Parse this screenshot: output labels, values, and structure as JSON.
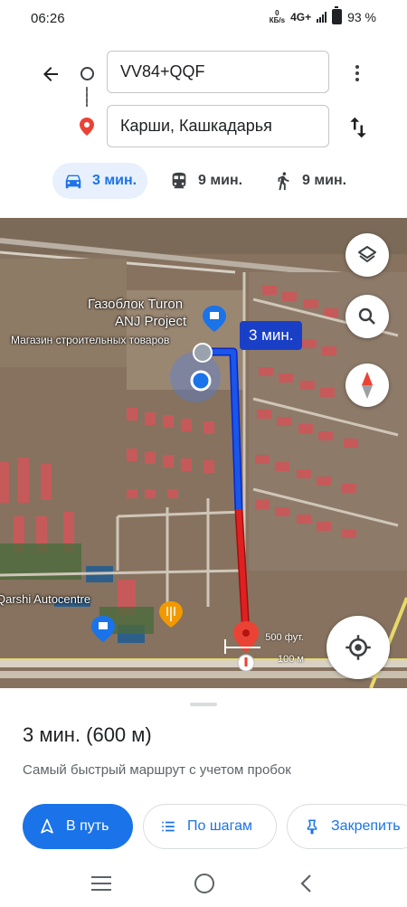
{
  "status_bar": {
    "time": "06:26",
    "net_speed_value": "0",
    "net_speed_unit": "КБ/s",
    "network": "4G+",
    "battery": "93 %"
  },
  "directions": {
    "from": "VV84+QQF",
    "to": "Карши, Кашкадарья",
    "icons": [
      "back-arrow-icon",
      "origin-dot-icon",
      "destination-pin-icon",
      "more-vert-icon",
      "swap-icon"
    ]
  },
  "modes": [
    {
      "icon": "car-icon",
      "label": "3 мин.",
      "selected": true
    },
    {
      "icon": "transit-icon",
      "label": "9 мин.",
      "selected": false
    },
    {
      "icon": "walk-icon",
      "label": "9 мин.",
      "selected": false
    }
  ],
  "map": {
    "labels": {
      "gazoblok": "Газоблок Turon",
      "anj": "ANJ Project",
      "magazin": "Магазин строительных товаров",
      "qarshi": "Qarshi Autocentre"
    },
    "eta": "3 мин.",
    "scale_ft": "500 фут.",
    "scale_m": "100 м",
    "route_colors": {
      "clear": "#1a56e8",
      "traffic": "#e02020"
    },
    "buttons": [
      "layers-icon",
      "search-icon",
      "compass-icon",
      "my-location-icon"
    ]
  },
  "sheet": {
    "title": "3 мин. (600 м)",
    "subtitle": "Самый быстрый маршрут с учетом пробок",
    "actions": {
      "start": "В путь",
      "steps": "По шагам",
      "pin": "Закрепить"
    }
  }
}
